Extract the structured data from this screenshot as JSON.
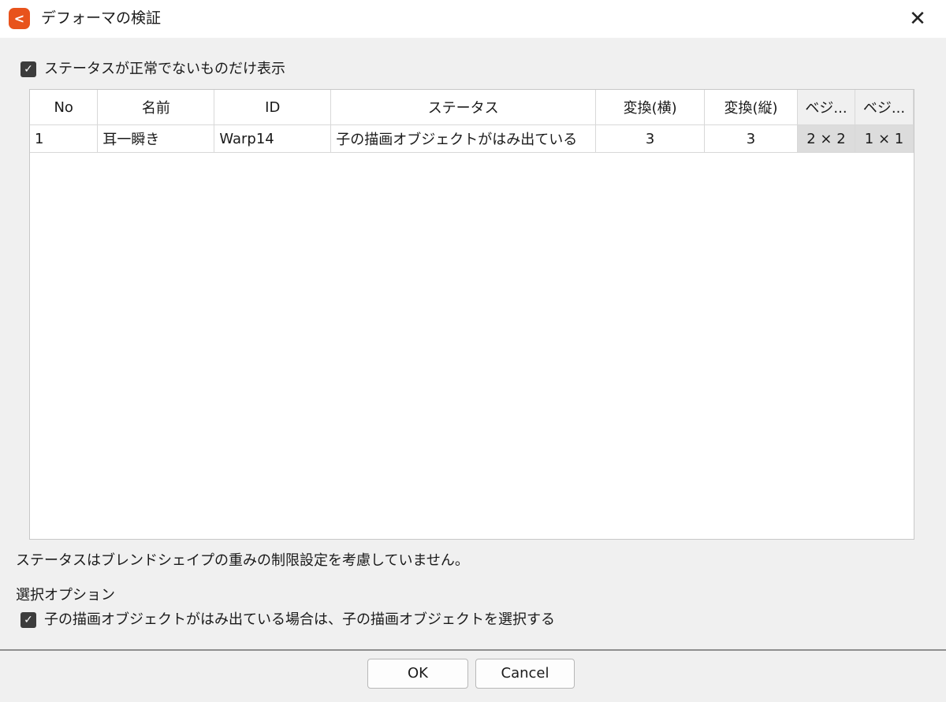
{
  "window": {
    "title": "デフォーマの検証",
    "close_glyph": "✕",
    "accent_color": "#e8531c"
  },
  "filter": {
    "checked": true,
    "label": "ステータスが正常でないものだけ表示"
  },
  "table": {
    "columns": [
      "No",
      "名前",
      "ID",
      "ステータス",
      "変換(横)",
      "変換(縦)",
      "ベジ...",
      "ベジ..."
    ],
    "rows": [
      {
        "no": "1",
        "name": "耳一瞬き",
        "id": "Warp14",
        "status": "子の描画オブジェクトがはみ出ている",
        "transform_h": "3",
        "transform_v": "3",
        "bezier1": "2 × 2",
        "bezier2": "1 × 1"
      }
    ]
  },
  "note": "ステータスはブレンドシェイプの重みの制限設定を考慮していません。",
  "options": {
    "section_label": "選択オプション",
    "select_child": {
      "checked": true,
      "label": "子の描画オブジェクトがはみ出ている場合は、子の描画オブジェクトを選択する"
    }
  },
  "buttons": {
    "ok": "OK",
    "cancel": "Cancel"
  },
  "icons": {
    "app_logo": "cubism-logo-icon",
    "check": "✓"
  }
}
